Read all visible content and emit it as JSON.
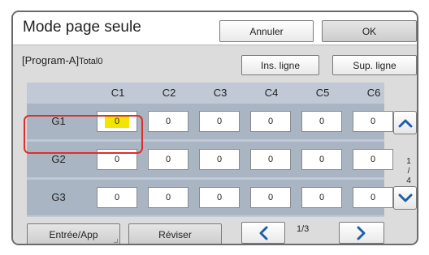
{
  "header": {
    "title": "Mode page seule",
    "cancel_label": "Annuler",
    "ok_label": "OK"
  },
  "program": {
    "name": "[Program-A]",
    "total": "Total0"
  },
  "toolbar": {
    "insert_row_label": "Ins. ligne",
    "delete_row_label": "Sup. ligne"
  },
  "grid": {
    "columns": [
      "C1",
      "C2",
      "C3",
      "C4",
      "C5",
      "C6"
    ],
    "rows": [
      {
        "label": "G1",
        "values": [
          "0",
          "0",
          "0",
          "0",
          "0",
          "0"
        ]
      },
      {
        "label": "G2",
        "values": [
          "0",
          "0",
          "0",
          "0",
          "0",
          "0"
        ]
      },
      {
        "label": "G3",
        "values": [
          "0",
          "0",
          "0",
          "0",
          "0",
          "0"
        ]
      }
    ],
    "active_cell": "G1-C1",
    "active_color": "#f2e600",
    "highlight_color": "#e02d2d"
  },
  "side_pager": {
    "current": "1",
    "separator": "/",
    "total": "4",
    "up_icon": "chevron-up-icon",
    "down_icon": "chevron-down-icon"
  },
  "footer": {
    "entry_label": "Entrée/App",
    "review_label": "Réviser",
    "page_text": "1/3",
    "prev_icon": "chevron-left-icon",
    "next_icon": "chevron-right-icon"
  },
  "colors": {
    "accent_blue": "#1f5fa8",
    "grid_background": "#c0c9d5",
    "row_band": "#a9b5c3"
  }
}
